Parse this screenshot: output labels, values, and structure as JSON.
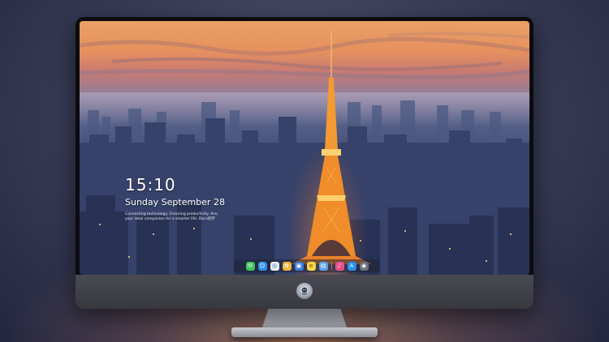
{
  "lock_screen": {
    "time": "15:10",
    "date": "Sunday September 28",
    "message_line1": "Connecting technology, Ensuring productivity. Ace,",
    "message_line2": "your ideal companion for a smarter life. Docs机宇"
  },
  "dock": {
    "items": [
      {
        "name": "messages-icon",
        "glyph": "✉",
        "color": "#3cc45a"
      },
      {
        "name": "finder-icon",
        "glyph": "☺",
        "color": "#2f8ee8"
      },
      {
        "name": "safari-icon",
        "glyph": "◎",
        "color": "#e9eef5"
      },
      {
        "name": "photos-icon",
        "glyph": "✿",
        "color": "#f0b340"
      },
      {
        "name": "clapper-icon",
        "glyph": "▣",
        "color": "#3a7be0"
      },
      {
        "name": "notes-icon",
        "glyph": "≡",
        "color": "#f5d54a"
      },
      {
        "name": "preview-icon",
        "glyph": "▤",
        "color": "#5aa0e8"
      },
      {
        "name": "music-icon",
        "glyph": "♪",
        "color": "#e8508a"
      },
      {
        "name": "app-store-icon",
        "glyph": "A",
        "color": "#2a8ef0"
      },
      {
        "name": "camera-icon",
        "glyph": "◉",
        "color": "#6a6f7a"
      }
    ]
  },
  "colors": {
    "sky_top": "#e9a066",
    "tower": "#f39a32"
  }
}
